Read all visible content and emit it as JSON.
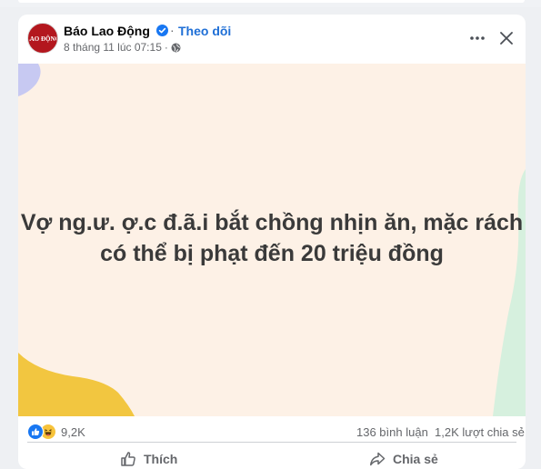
{
  "post": {
    "page_name": "Báo Lao Động",
    "separator": "·",
    "follow_label": "Theo dõi",
    "timestamp": "8 tháng 11 lúc 07:15",
    "meta_separator": "·",
    "avatar_logo_text": "LAO ĐỘNG",
    "body_line_1": "Vợ ng.ư. ợ.c đ.ã.i bắt chồng nhịn ăn, mặc rách",
    "body_line_2": "có thể bị phạt đến 20 triệu đồng",
    "background_color": "#fdf1e6"
  },
  "stats": {
    "reaction_count": "9,2K",
    "comments": "136 bình luận",
    "shares": "1,2K lượt chia sẻ"
  },
  "actions": {
    "like_label": "Thích",
    "share_label": "Chia sẻ"
  },
  "icons": {
    "verified": "verified-badge-icon",
    "globe": "globe-icon",
    "more": "more-options-icon",
    "close": "close-icon",
    "like": "like-reaction-icon",
    "haha": "haha-reaction-icon"
  },
  "colors": {
    "accent": "#1f6fd6",
    "brand_red": "#b3171e",
    "text_secondary": "#65676b"
  }
}
